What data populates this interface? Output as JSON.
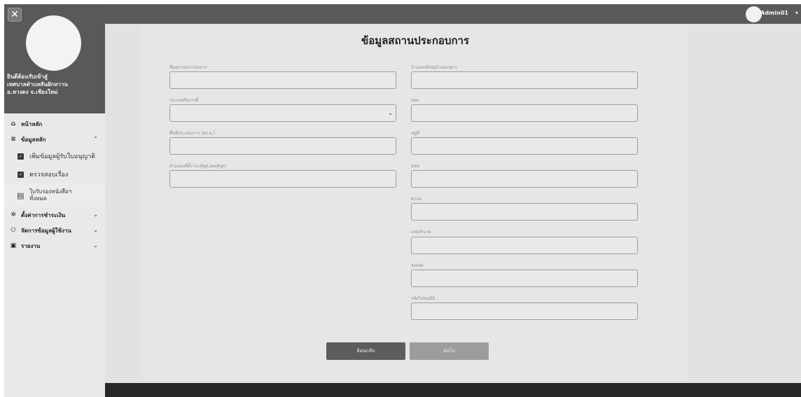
{
  "sidebar": {
    "close_label": "✕",
    "welcome": [
      "ยินดีต้อนรับเข้าสู่",
      "เทศบาลตำบลสันผักหวาน",
      "อ.หางดง จ.เชียงใหม่"
    ],
    "menu": {
      "home": "หน้าหลัก",
      "master": "ข้อมูลหลัก",
      "sub_add": "เพิ่มข้อมูลผู้รับใบอนุญาติ",
      "sub_check": "ตรวจสอบเรื่อง",
      "sub_receipt_line1": "ใบรับรองหนังสือฯ",
      "sub_receipt_line2": "ทั้งหมด",
      "payment": "ตั้งค่าการชำระเงิน",
      "users": "จัดการข้อมูลผู้ใช้งาน",
      "report": "รายงาน"
    }
  },
  "topbar": {
    "username": "Admin01"
  },
  "form": {
    "title": "ข้อมูลสถานประกอบการ",
    "left": [
      {
        "label": "ชื่อสถานประกอบการ",
        "value": ""
      },
      {
        "label": "ประเภทกิจการที่",
        "value": ""
      },
      {
        "label": "พื้นที่ประกอบการ (ตร.ม.)",
        "value": ""
      },
      {
        "label": "ตำแหน่งที่ตั้ง (ละติจูด,ลองติจูด)",
        "value": "  ·"
      }
    ],
    "right": [
      {
        "label": "บ้านเลขที่/หมู่บ้าน/อาคาร",
        "value": ""
      },
      {
        "label": "ซอย",
        "value": ""
      },
      {
        "label": "หมู่ที่",
        "value": ""
      },
      {
        "label": "ถนน",
        "value": ""
      },
      {
        "label": "ตำบล",
        "value": ""
      },
      {
        "label": "เขต/อำเภอ",
        "value": ""
      },
      {
        "label": "จังหวัด",
        "value": ""
      },
      {
        "label": "รหัสไปรษณีย์",
        "value": ""
      }
    ],
    "back_label": "ย้อนกลับ",
    "next_label": "ต่อไป"
  },
  "colors": {
    "header": "#595959",
    "footer": "#282828",
    "btn_back": "#5d5d5d",
    "btn_next": "#9c9c9c"
  }
}
